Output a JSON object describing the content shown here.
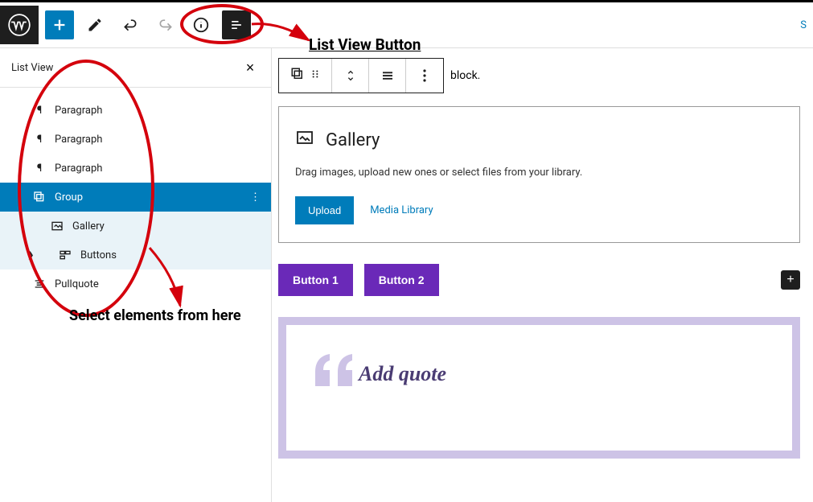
{
  "panel_title": "List View",
  "tree": {
    "items": [
      {
        "label": "Paragraph"
      },
      {
        "label": "Paragraph"
      },
      {
        "label": "Paragraph"
      },
      {
        "label": "Group",
        "selected": true
      },
      {
        "label": "Gallery",
        "child": true
      },
      {
        "label": "Buttons",
        "child": true,
        "expandable": true
      },
      {
        "label": "Pullquote"
      }
    ]
  },
  "trailing_text": "block.",
  "gallery": {
    "title": "Gallery",
    "desc": "Drag images, upload new ones or select files from your library.",
    "upload_label": "Upload",
    "media_library_label": "Media Library"
  },
  "buttons": {
    "b1": "Button 1",
    "b2": "Button 2"
  },
  "pullquote": {
    "placeholder": "Add quote"
  },
  "annotations": {
    "list_view_label": "List View Button",
    "select_label": "Select elements from here"
  },
  "colors": {
    "accent": "#007cba",
    "purple": "#6a29b8",
    "pull_border": "#cdc3e6",
    "annotation": "#d4000c"
  },
  "toolbar_right": "S"
}
